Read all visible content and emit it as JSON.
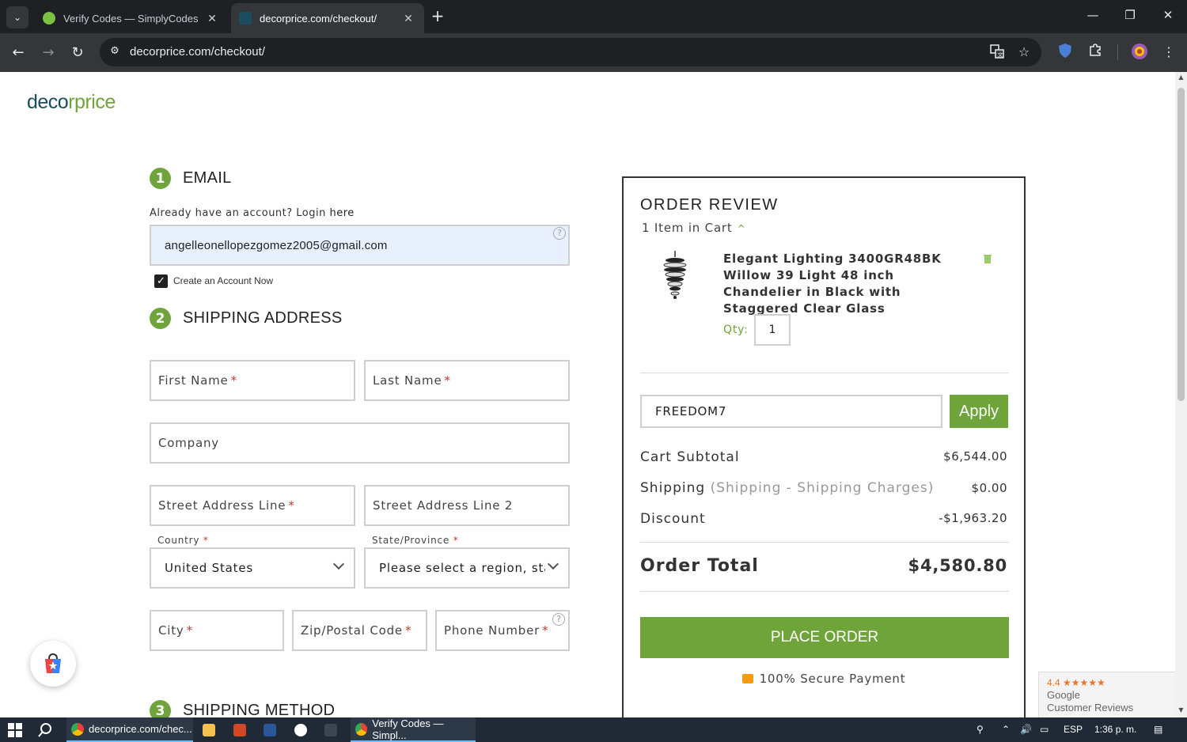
{
  "browser": {
    "tabs": [
      {
        "title": "Verify Codes — SimplyCodes",
        "close": "✕",
        "active": false
      },
      {
        "title": "decorprice.com/checkout/",
        "close": "✕",
        "active": true
      }
    ],
    "new_tab": "+",
    "url": "decorprice.com/checkout/",
    "window_controls": {
      "minimize": "—",
      "restore": "❐",
      "close": "✕"
    },
    "nav": {
      "back": "←",
      "forward": "→",
      "reload": "↻"
    },
    "icons": {
      "translate": "translate-icon",
      "bookmark": "star-icon",
      "extension_shield": "shield-icon",
      "extensions": "puzzle-icon",
      "menu": "kebab-menu-icon"
    }
  },
  "logo": {
    "part1": "deco",
    "part2": "r",
    "part3": "price"
  },
  "email_section": {
    "step": "1",
    "heading": "EMAIL",
    "login_prompt": "Already have an account? Login",
    "login_link": "here",
    "email_value": "angelleonellopezgomez2005@gmail.com",
    "create_account_label": "Create an Account Now",
    "create_account_checked": true
  },
  "shipping_section": {
    "step": "2",
    "heading": "SHIPPING ADDRESS",
    "first_name": "First Name",
    "last_name": "Last Name",
    "company": "Company",
    "street1": "Street Address Line",
    "street2": "Street Address Line 2",
    "country_label": "Country",
    "country_value": "United States",
    "state_label": "State/Province",
    "state_value": "Please select a region, stat",
    "city": "City",
    "zip": "Zip/Postal Code",
    "phone": "Phone Number",
    "required_mark": "*"
  },
  "shipping_method": {
    "step": "3",
    "heading": "SHIPPING METHOD"
  },
  "order_review": {
    "title": "ORDER REVIEW",
    "items_count": "1 Item in Cart",
    "caret": "^",
    "product_name": "Elegant Lighting 3400GR48BK Willow 39 Light 48 inch Chandelier in Black with Staggered Clear Glass",
    "qty_label": "Qty:",
    "qty_value": "1",
    "coupon_value": "FREEDOM7",
    "apply_label": "Apply",
    "subtotal_label": "Cart Subtotal",
    "subtotal_value": "$6,544.00",
    "shipping_label": "Shipping",
    "shipping_detail": "(Shipping - Shipping Charges)",
    "shipping_value": "$0.00",
    "discount_label": "Discount",
    "discount_value": "-$1,963.20",
    "total_label": "Order Total",
    "total_value": "$4,580.80",
    "place_order_label": "PLACE ORDER",
    "secure_label": "100% Secure Payment"
  },
  "google_reviews": {
    "rating": "4.4 ★★★★★",
    "line1": "Google",
    "line2": "Customer Reviews"
  },
  "taskbar": {
    "items": [
      {
        "label": "decorprice.com/chec..."
      },
      {
        "label": "Verify Codes — Simpl..."
      }
    ],
    "lang": "ESP",
    "time": "1:36 p. m."
  }
}
